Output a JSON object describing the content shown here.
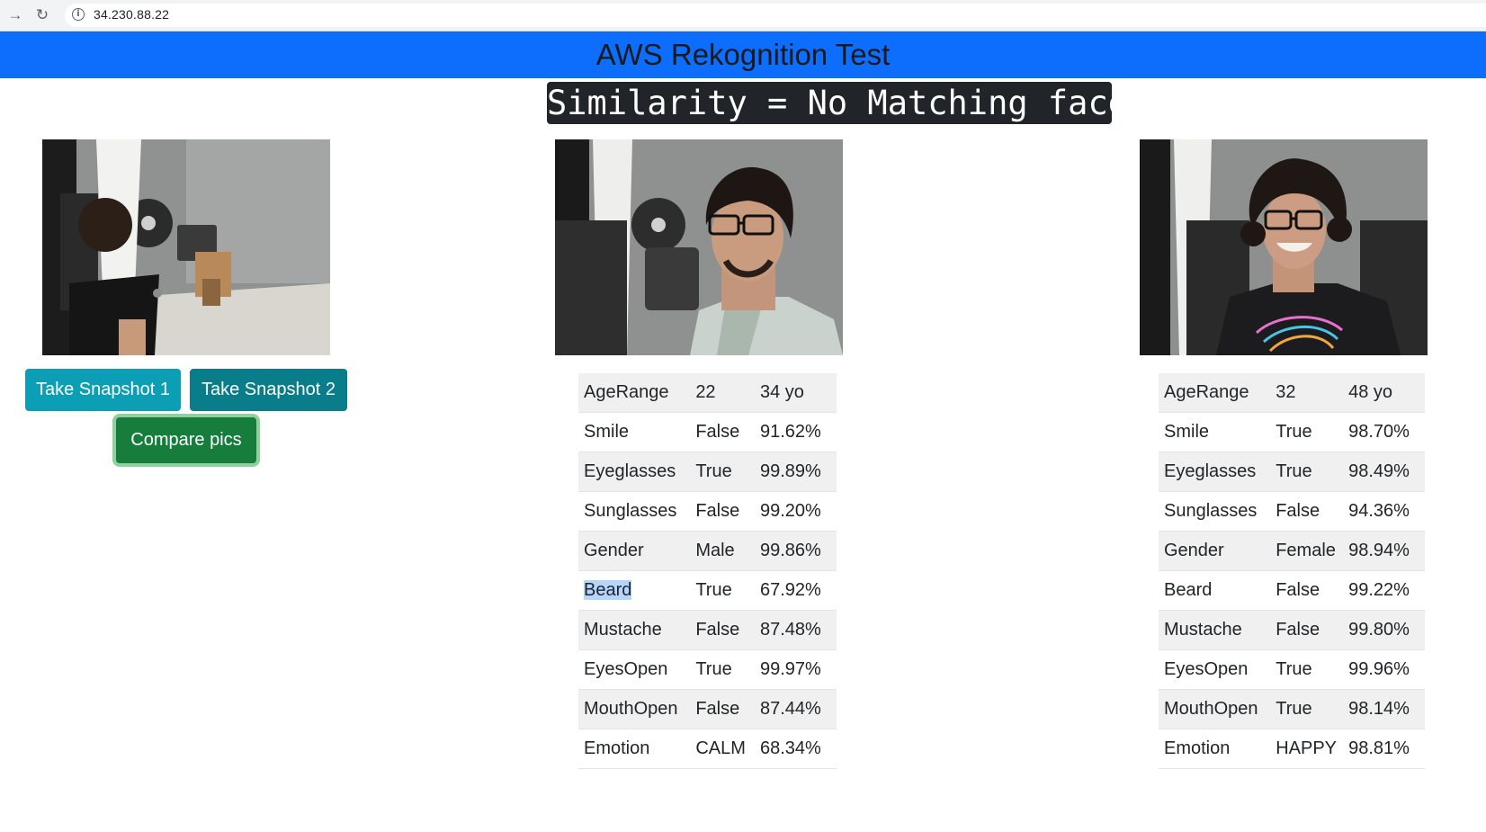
{
  "browser": {
    "url": "34.230.88.22",
    "icons": {
      "forward": "forward-arrow-icon",
      "reload": "reload-icon",
      "info": "info-icon"
    }
  },
  "header": {
    "title": "AWS Rekognition Test",
    "color": "#0d6efd"
  },
  "similarity": {
    "text": "Similarity = No Matching face"
  },
  "controls": {
    "snapshot1_label": "Take Snapshot 1",
    "snapshot2_label": "Take Snapshot 2",
    "compare_label": "Compare pics"
  },
  "face1": {
    "rows": [
      [
        "AgeRange",
        "22",
        "34 yo"
      ],
      [
        "Smile",
        "False",
        "91.62%"
      ],
      [
        "Eyeglasses",
        "True",
        "99.89%"
      ],
      [
        "Sunglasses",
        "False",
        "99.20%"
      ],
      [
        "Gender",
        "Male",
        "99.86%"
      ],
      [
        "Beard",
        "True",
        "67.92%"
      ],
      [
        "Mustache",
        "False",
        "87.48%"
      ],
      [
        "EyesOpen",
        "True",
        "99.97%"
      ],
      [
        "MouthOpen",
        "False",
        "87.44%"
      ],
      [
        "Emotion",
        "CALM",
        "68.34%"
      ]
    ]
  },
  "face2": {
    "rows": [
      [
        "AgeRange",
        "32",
        "48 yo"
      ],
      [
        "Smile",
        "True",
        "98.70%"
      ],
      [
        "Eyeglasses",
        "True",
        "98.49%"
      ],
      [
        "Sunglasses",
        "False",
        "94.36%"
      ],
      [
        "Gender",
        "Female",
        "98.94%"
      ],
      [
        "Beard",
        "False",
        "99.22%"
      ],
      [
        "Mustache",
        "False",
        "99.80%"
      ],
      [
        "EyesOpen",
        "True",
        "99.96%"
      ],
      [
        "MouthOpen",
        "True",
        "98.14%"
      ],
      [
        "Emotion",
        "HAPPY",
        "98.81%"
      ]
    ]
  }
}
